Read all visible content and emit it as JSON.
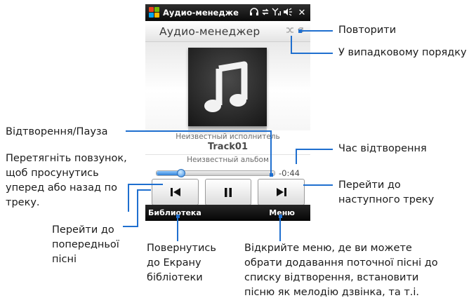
{
  "status_bar": {
    "title": "Аудио-менедже",
    "icons": [
      "windows-logo",
      "headset-icon",
      "sync-icon",
      "signal-icon",
      "volume-icon",
      "close-icon"
    ],
    "close_glyph": "✕"
  },
  "app": {
    "title": "Аудио-менеджер",
    "shuffle_icon": "shuffle-icon",
    "repeat_icon": "repeat-icon"
  },
  "now_playing": {
    "artist": "Неизвестный исполнитель",
    "track": "Track01",
    "album": "Неизвестный альбом",
    "time_remaining": "-0:44",
    "progress": 0.2
  },
  "controls": {
    "prev": "previous-track-icon",
    "play_pause": "pause-icon",
    "next": "next-track-icon"
  },
  "softkeys": {
    "left": "Библиотека",
    "right": "Меню"
  },
  "callouts": {
    "repeat": "Повторити",
    "shuffle": "У випадковому порядку",
    "play_pause": "Відтворення/Пауза",
    "seek": "Перетягніть повзунок, щоб просунутись уперед або назад по треку.",
    "playback_time": "Час відтворення",
    "next_track": "Перейти до наступного треку",
    "prev_track": "Перейти до попередньої пісні",
    "library": "Повернутись до Екрану бібліотеки",
    "menu": "Відкрийте меню, де ви можете обрати додавання поточної пісні до списку відтворення, встановити пісню як мелодію дзвінка, та т.і."
  },
  "colors": {
    "accent_line": "#1f6fcf",
    "status_bar": "#111111",
    "seek_fill": "#2d7fd6"
  }
}
